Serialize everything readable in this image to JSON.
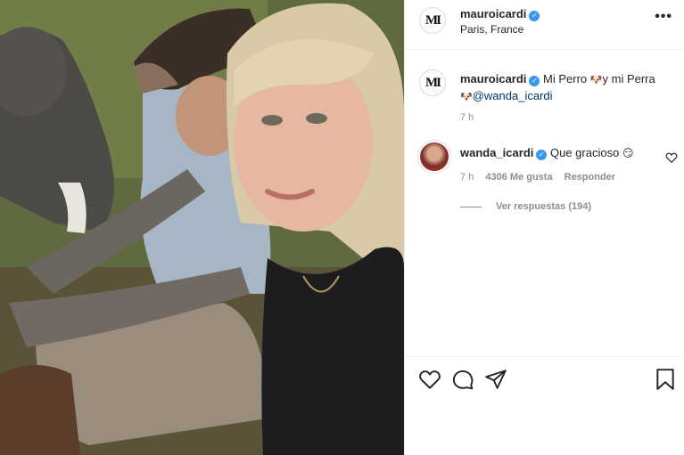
{
  "header": {
    "avatar_letters": "MI",
    "username": "mauroicardi",
    "location": "Paris, France",
    "more_label": "•••"
  },
  "caption": {
    "avatar_letters": "MI",
    "username": "mauroicardi",
    "text_before": "Mi Perro",
    "text_middle": "y mi Perra",
    "mention": "@wanda_icardi",
    "time": "7 h",
    "emoji_icon": "dog-face-icon"
  },
  "comment": {
    "username": "wanda_icardi",
    "text": "Que gracioso",
    "emoji_icon": "smirk-face-icon",
    "time": "7 h",
    "likes": "4306 Me gusta",
    "reply_label": "Responder",
    "view_replies": "Ver respuestas (194)"
  },
  "actions": {
    "icons": [
      "heart-icon",
      "comment-icon",
      "share-icon",
      "bookmark-icon"
    ]
  },
  "colors": {
    "verified": "#3897f0",
    "text": "#262626",
    "secondary": "#8e8e8e",
    "mention": "#00376b"
  }
}
